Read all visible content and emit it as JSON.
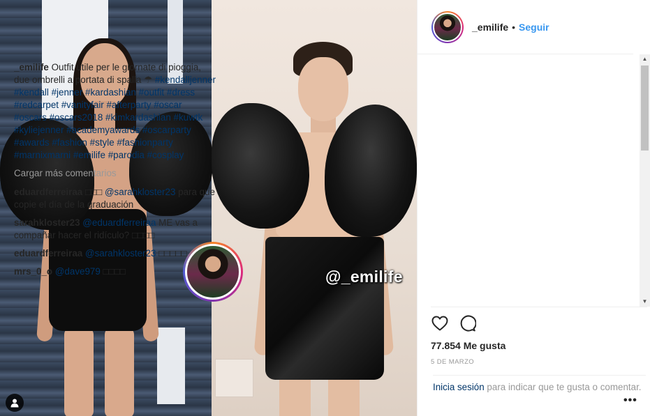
{
  "photo": {
    "watermark": "@_emilife"
  },
  "header": {
    "username": "_emilife",
    "separator": "•",
    "follow_label": "Seguir"
  },
  "caption": {
    "username": "_emilife",
    "text": "Outfit utile per le giornate di pioggia, due ombrelli a portata di spalla ☂",
    "hashtags": "#kendalljenner #kendall #jenner #kardashian #outfit #dress #redcarpet #vanityfair #afterparty #oscar #oscars #oscars2018 #kimkardashian #kuwtk #kyliejenner #academyawards #oscarparty #awards #fashion #style #fashionparty #marnixmarni #emilife #parodia #cosplay"
  },
  "load_more": "Cargar más comentarios",
  "comments": [
    {
      "user": "eduardferreiraa",
      "text": "",
      "mention": "@sarahkloster23",
      "rest": "para que copie el día de la graduación"
    },
    {
      "user": "sarahkloster23",
      "text": "",
      "mention": "@eduardferreiraa",
      "rest": "ME vas a compañar hacer el ridículo? "
    },
    {
      "user": "eduardferreiraa",
      "text": "",
      "mention": "@sarahkloster23",
      "rest": ""
    },
    {
      "user": "mrs_0_o",
      "text": "",
      "mention": "@dave979",
      "rest": ""
    }
  ],
  "actions": {
    "likes": "77.854 Me gusta",
    "date": "5 de marzo"
  },
  "login": {
    "link": "Inicia sesión",
    "text": " para indicar que te gusta o comentar."
  },
  "more_label": "•••",
  "icons": [
    "heart-icon",
    "comment-icon",
    "user-tag-icon",
    "more-options-icon",
    "scroll-up-icon",
    "scroll-down-icon"
  ]
}
